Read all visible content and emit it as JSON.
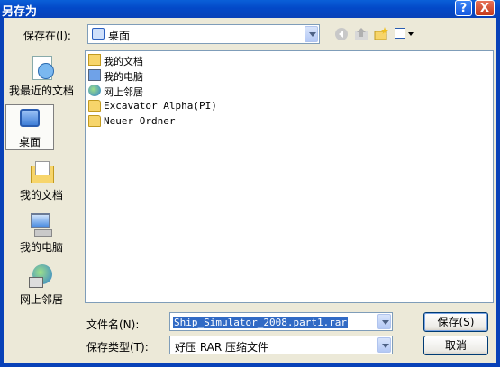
{
  "window": {
    "title": "另存为",
    "help_label": "?",
    "close_label": "X"
  },
  "save_in": {
    "label": "保存在(I):",
    "value": "桌面",
    "icon": "desktop-icon"
  },
  "toolbar": {
    "icons": [
      "back-icon",
      "up-folder-icon",
      "new-folder-icon",
      "view-menu-icon"
    ]
  },
  "places": [
    {
      "label": "我最近的文档",
      "icon": "recent-documents-icon"
    },
    {
      "label": "桌面",
      "icon": "desktop-icon",
      "active": true
    },
    {
      "label": "我的文档",
      "icon": "my-documents-icon"
    },
    {
      "label": "我的电脑",
      "icon": "my-computer-icon"
    },
    {
      "label": "网上邻居",
      "icon": "network-places-icon"
    }
  ],
  "files": [
    {
      "name": "我的文档",
      "icon": "my-documents-icon"
    },
    {
      "name": "我的电脑",
      "icon": "my-computer-icon"
    },
    {
      "name": "网上邻居",
      "icon": "network-places-icon"
    },
    {
      "name": "Excavator Alpha(PI)",
      "icon": "folder-icon"
    },
    {
      "name": "Neuer Ordner",
      "icon": "folder-icon"
    }
  ],
  "filename": {
    "label": "文件名(N):",
    "value": "Ship_Simulator_2008.part1.rar"
  },
  "filetype": {
    "label": "保存类型(T):",
    "value": "好压 RAR 压缩文件"
  },
  "buttons": {
    "save": "保存(S)",
    "cancel": "取消"
  }
}
